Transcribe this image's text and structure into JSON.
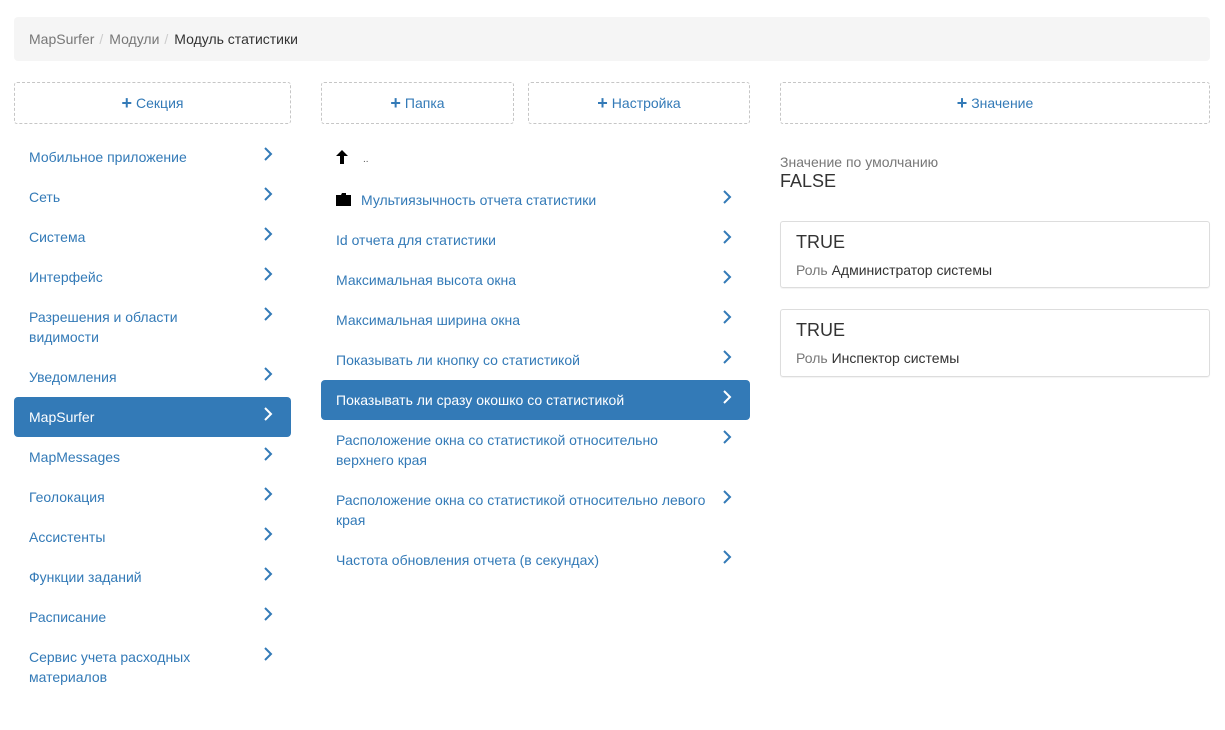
{
  "breadcrumb": {
    "items": [
      "MapSurfer",
      "Модули"
    ],
    "separator": "/",
    "current": "Модуль статистики"
  },
  "buttons": {
    "add_section": "Секция",
    "add_folder": "Папка",
    "add_setting": "Настройка",
    "add_value": "Значение",
    "plus_icon": "+"
  },
  "sections": {
    "active_index": 6,
    "items": [
      "Мобильное приложение",
      "Сеть",
      "Система",
      "Интерфейс",
      "Разрешения и области видимости",
      "Уведомления",
      "MapSurfer",
      "MapMessages",
      "Геолокация",
      "Ассистенты",
      "Функции заданий",
      "Расписание",
      "Сервис учета расходных материалов"
    ]
  },
  "settings": {
    "up_label": "..",
    "folder": "Мультиязычность отчета статистики",
    "active_index": 4,
    "items": [
      "Id отчета для статистики",
      "Максимальная высота окна",
      "Максимальная ширина окна",
      "Показывать ли кнопку со статистикой",
      "Показывать ли сразу окошко со статистикой",
      "Расположение окна со статистикой относительно верхнего края",
      "Расположение окна со статистикой относительно левого края",
      "Частота обновления отчета (в секундах)"
    ]
  },
  "values": {
    "default_label": "Значение по умолчанию",
    "default_value": "FALSE",
    "role_label": "Роль",
    "cards": [
      {
        "value": "TRUE",
        "role": "Администратор системы"
      },
      {
        "value": "TRUE",
        "role": "Инспектор системы"
      }
    ]
  },
  "colors": {
    "accent": "#337ab7",
    "breadcrumb_bg": "#f5f5f5"
  },
  "icons": {
    "chevron": "chevron-right-icon",
    "up": "arrow-up-icon",
    "folder": "folder-icon",
    "plus": "plus-icon"
  }
}
